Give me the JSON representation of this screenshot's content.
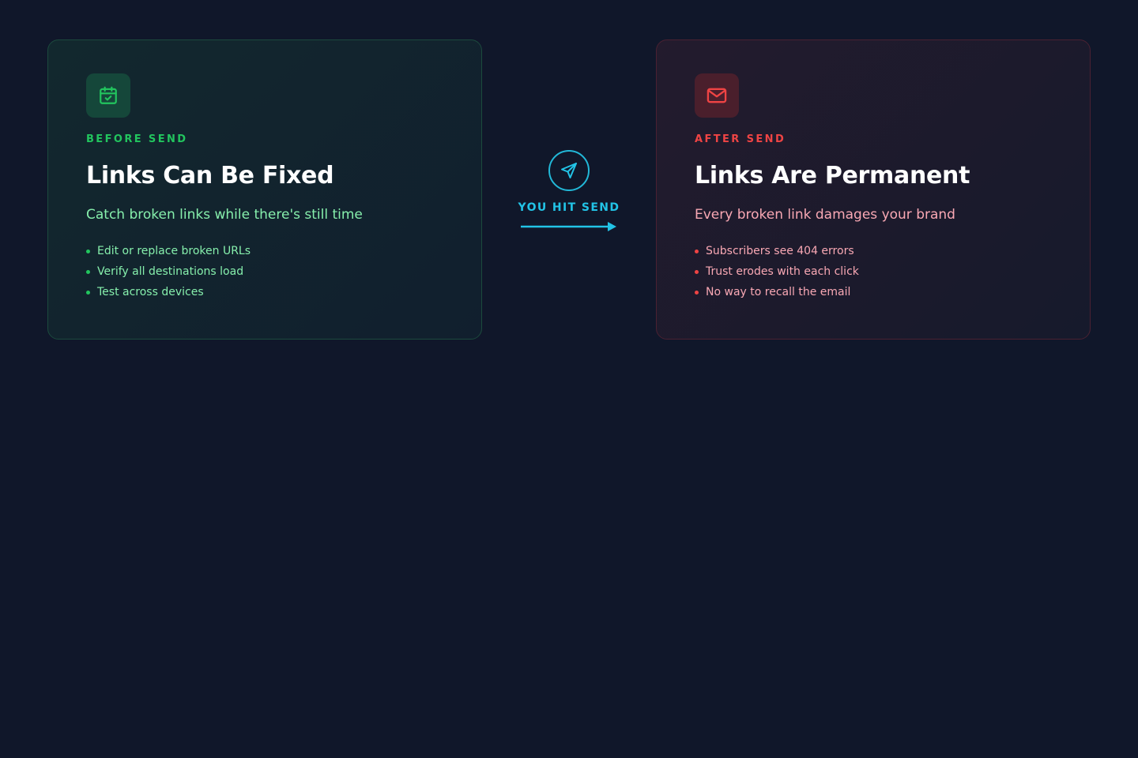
{
  "colors": {
    "background": "#10172a",
    "before_accent": "#22c55e",
    "before_text": "#86efac",
    "after_accent": "#ef4444",
    "after_text": "#f9a8b4",
    "send_accent": "#22c3e6"
  },
  "before": {
    "icon": "calendar-check-icon",
    "eyebrow": "BEFORE SEND",
    "title": "Links Can Be Fixed",
    "subtitle": "Catch broken links while there's still time",
    "points": [
      "Edit or replace broken URLs",
      "Verify all destinations load",
      "Test across devices"
    ]
  },
  "middle": {
    "icon": "send-icon",
    "label": "YOU HIT SEND",
    "arrow_icon": "arrow-right-icon"
  },
  "after": {
    "icon": "mail-icon",
    "eyebrow": "AFTER SEND",
    "title": "Links Are Permanent",
    "subtitle": "Every broken link damages your brand",
    "points": [
      "Subscribers see 404 errors",
      "Trust erodes with each click",
      "No way to recall the email"
    ]
  }
}
